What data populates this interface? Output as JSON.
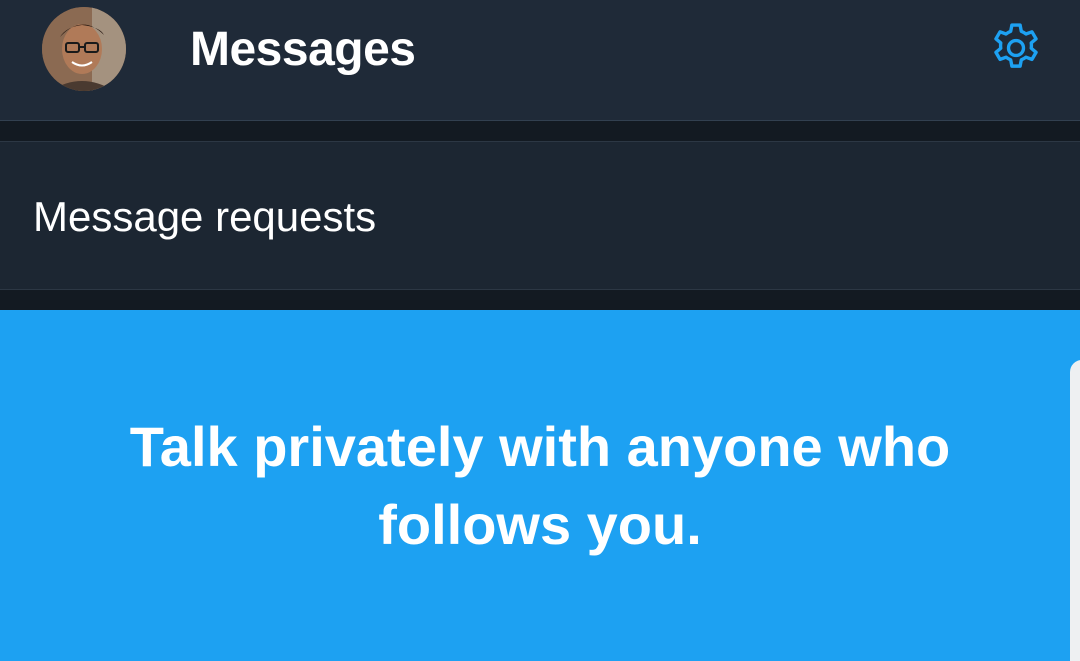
{
  "header": {
    "title": "Messages",
    "avatar_icon": "profile-photo",
    "settings_icon": "gear-icon"
  },
  "requests": {
    "label": "Message requests"
  },
  "promo": {
    "text": "Talk privately with anyone who follows you."
  },
  "colors": {
    "header_bg": "#1f2a38",
    "page_bg": "#141d26",
    "row_bg": "#1c2632",
    "accent": "#1da1f2",
    "text": "#ffffff"
  }
}
